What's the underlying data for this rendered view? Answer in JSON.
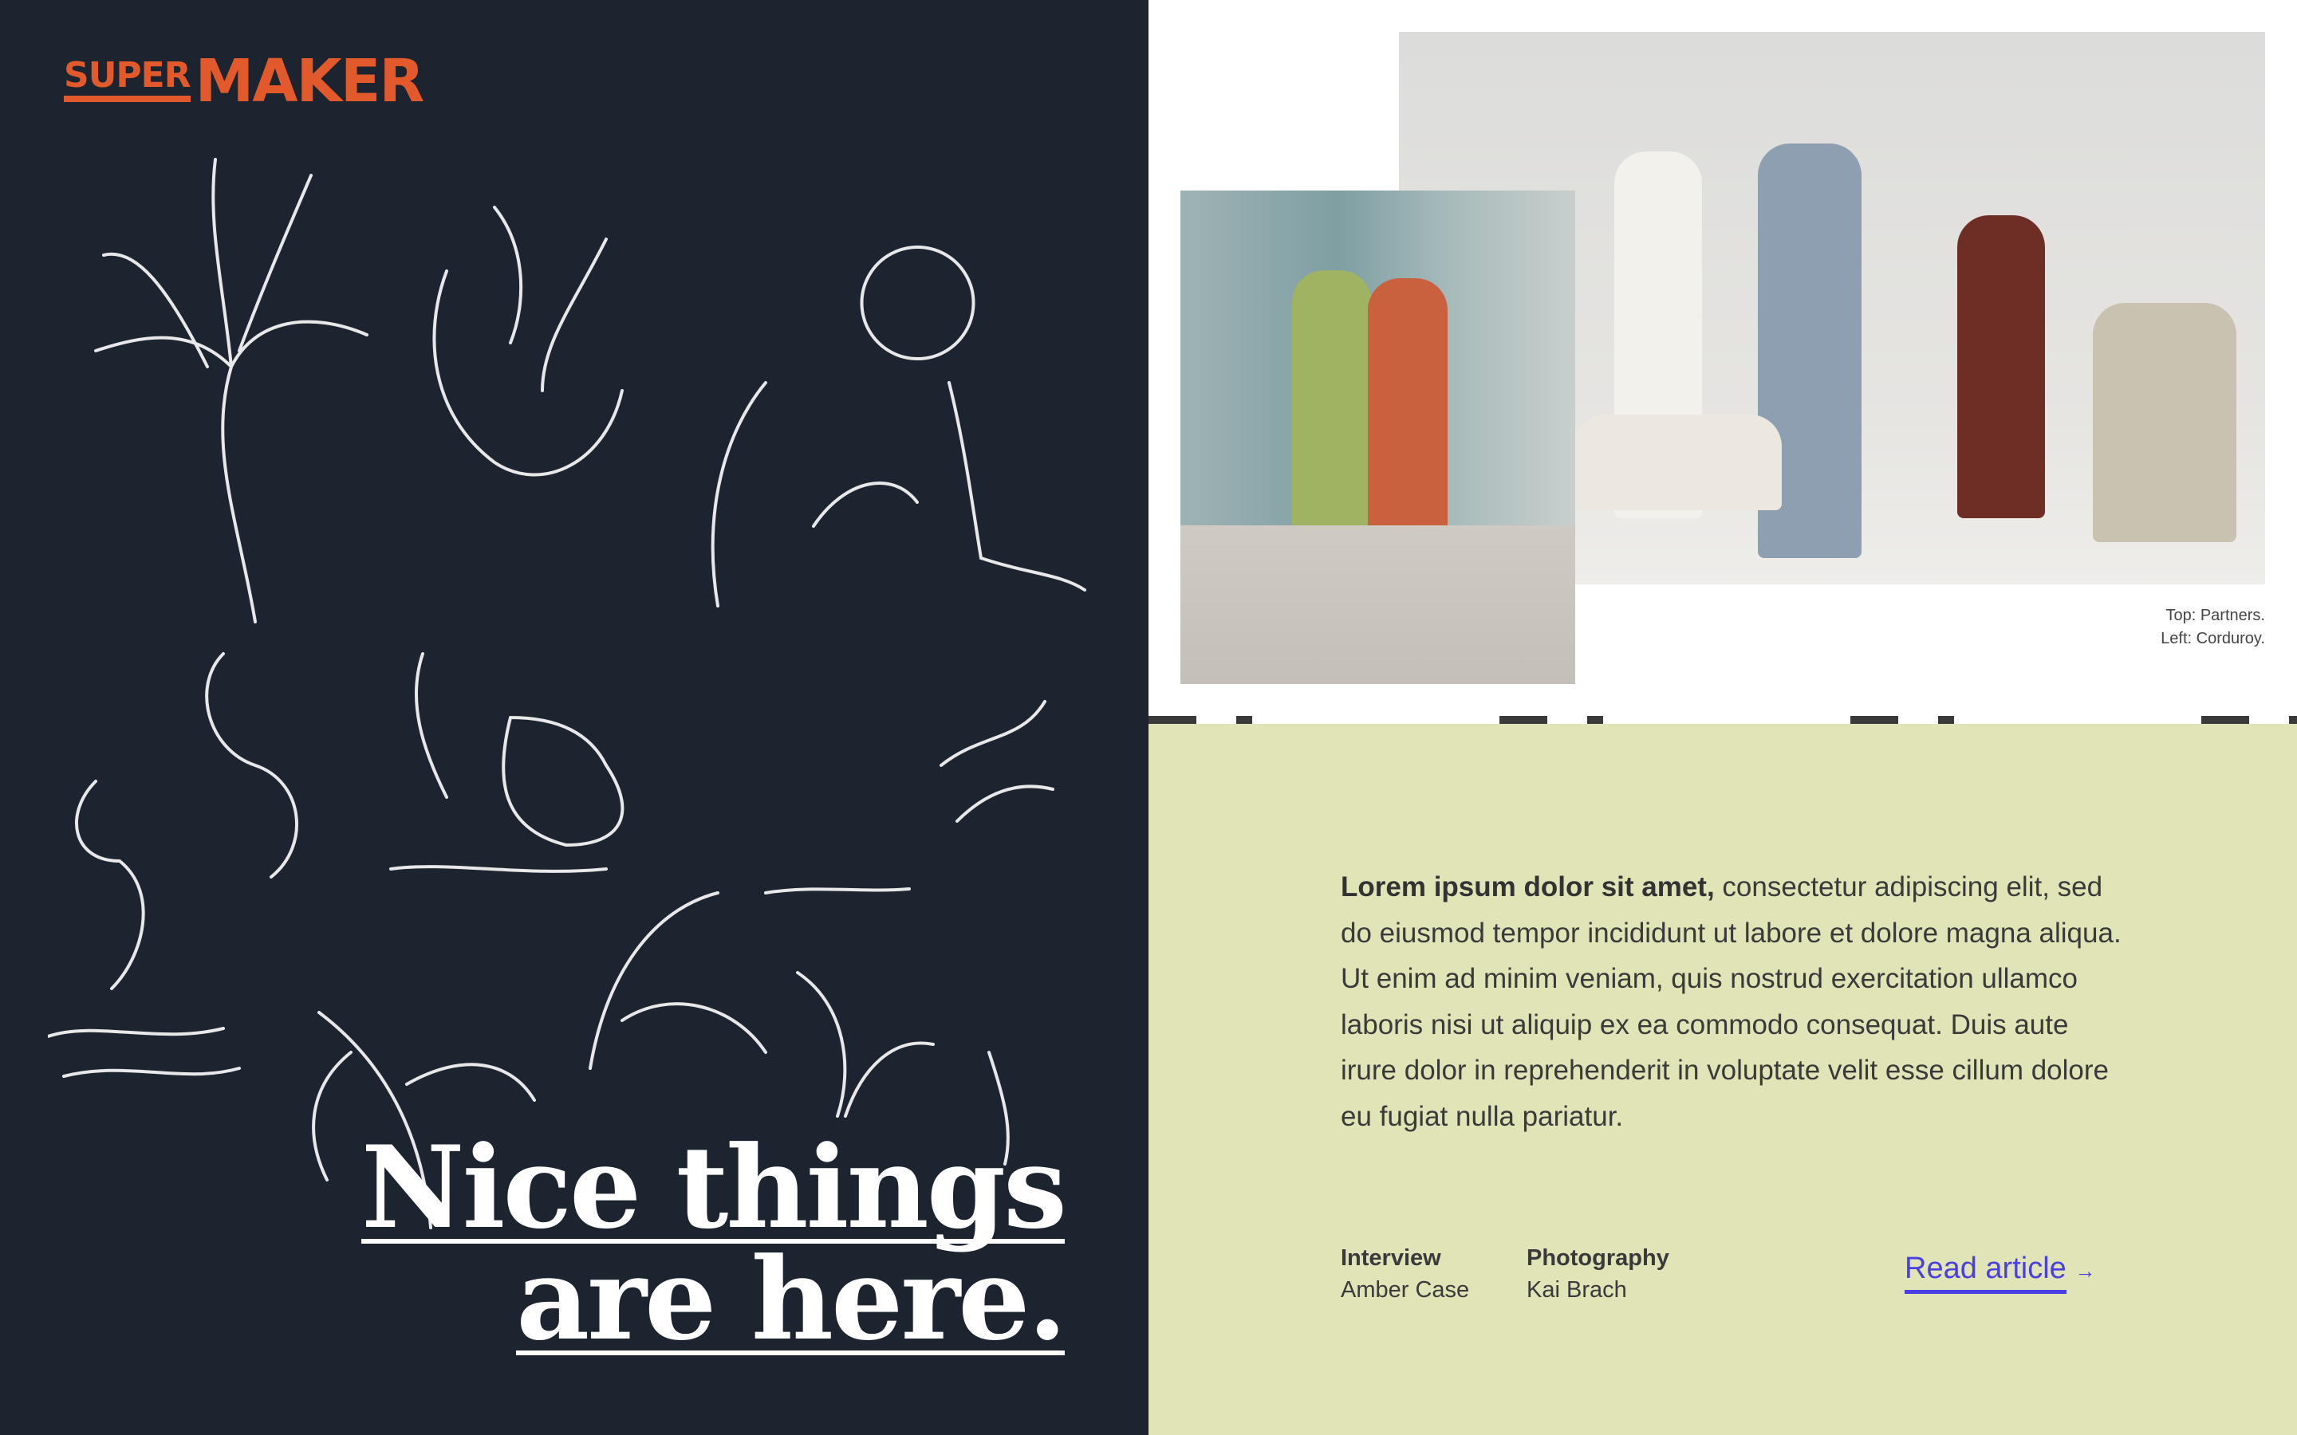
{
  "logo": {
    "super": "SUPER",
    "maker": "MAKER"
  },
  "headline": {
    "line1": "Nice things",
    "line2": "are here."
  },
  "caption": {
    "top": "Top: Partners.",
    "left": "Left: Corduroy."
  },
  "article": {
    "lead": "Lorem ipsum dolor sit amet,",
    "body": " consectetur adipiscing elit, sed do eiusmod tempor incididunt ut labore et dolore magna aliqua. Ut enim ad minim veniam, quis nostrud exercitation ullamco laboris nisi ut aliquip ex ea commodo consequat. Duis aute irure dolor in reprehenderit in voluptate velit esse cillum dolore eu fugiat nulla pariatur."
  },
  "credits": [
    {
      "role": "Interview",
      "name": "Amber Case"
    },
    {
      "role": "Photography",
      "name": "Kai Brach"
    }
  ],
  "cta": {
    "label": "Read article",
    "arrow": "→"
  },
  "colors": {
    "dark": "#1c2430",
    "accent": "#e2592b",
    "green": "#e1e4b7",
    "link": "#4a3fe0"
  }
}
